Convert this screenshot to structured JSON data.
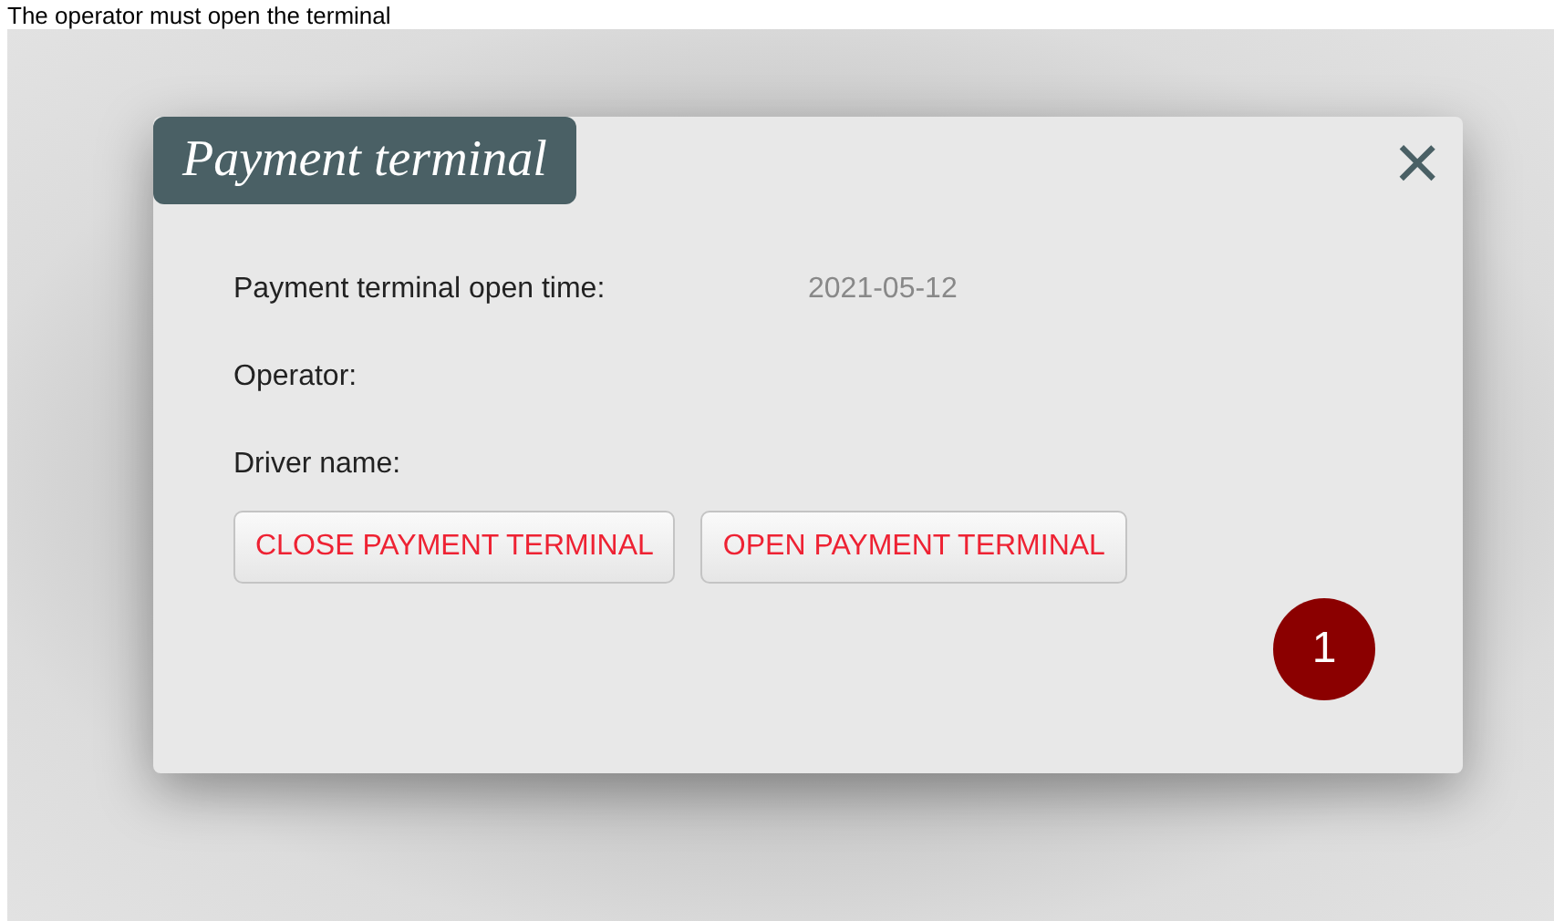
{
  "caption": "The operator must open the terminal",
  "dialog": {
    "title": "Payment terminal",
    "close": "×",
    "fields": [
      {
        "label": "Payment terminal open time:",
        "value": "2021-05-12"
      },
      {
        "label": "Operator:"
      },
      {
        "label": "Driver name:"
      }
    ],
    "buttons": [
      "CLOSE PAYMENT TERMINAL",
      "OPEN PAYMENT TERMINAL"
    ],
    "badge": "1"
  }
}
